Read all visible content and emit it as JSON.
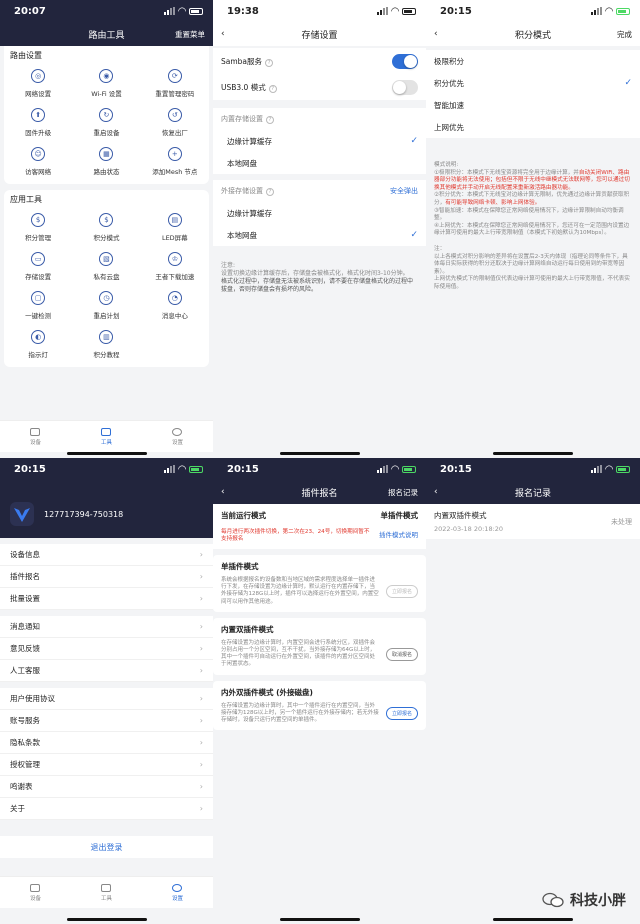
{
  "status": {
    "p1_time": "20:07",
    "p2_time": "19:38",
    "p3_time": "20:15",
    "p4_time": "20:15",
    "p5_time": "20:15",
    "p6_time": "20:15"
  },
  "p1": {
    "title": "路由工具",
    "right": "重置菜单",
    "section1": "路由设置",
    "router_items": [
      "网络设置",
      "Wi-Fi 设置",
      "重置管理密码",
      "固件升级",
      "重启设备",
      "恢复出厂",
      "访客网络",
      "路由状态",
      "添加Mesh 节点"
    ],
    "section2": "应用工具",
    "app_items": [
      "积分管理",
      "积分模式",
      "LED屏幕",
      "存储设置",
      "私有云盘",
      "王者下载加速",
      "一键检测",
      "重启计划",
      "消息中心",
      "指示灯",
      "积分教程"
    ],
    "tabs": [
      "设备",
      "工具",
      "设置"
    ]
  },
  "p2": {
    "title": "存储设置",
    "samba": "Samba服务",
    "usb": "USB3.0 模式",
    "internal_title": "内置存储设置",
    "internal_opts": [
      "边缘计算缓存",
      "本地网盘"
    ],
    "external_title": "外接存储设置",
    "eject": "安全弹出",
    "external_opts": [
      "边缘计算缓存",
      "本地网盘"
    ],
    "note_title": "注意:",
    "note_body": "设置切换边缘计算缓存后，存储盘会被格式化，格式化时间3-10分钟。",
    "note_body2": "格式化过程中，存储盘无法被系统识别，请不要在存储盘格式化的过程中拔盘，否则存储盘会有损坏的风险。"
  },
  "p3": {
    "title": "积分模式",
    "done": "完成",
    "options": [
      "极限积分",
      "积分优先",
      "智能加速",
      "上网优先"
    ],
    "explain_title": "模式说明:",
    "explain_1a": "①极限积分：本模式下无线宝资源将完全用于边缘计算，并",
    "explain_1b": "自动关闭WiFi、路由器部分功能将无法使用；包括但不限于无线中继模式无法联网等，您可以通过切换其他模式并手动开启无线配置来重新激活路由器功能。",
    "explain_2a": "②积分优先：本模式下无线宝对边缘计算无限制，优先通过边缘计算贡献获取积分，",
    "explain_2b": "有可能导致网络卡顿、影响上网体验。",
    "explain_3": "③智能加速：本模式在保障您正常网络使用情况下，边缘计算限制自动均衡调整。",
    "explain_4": "④上网优先：本模式在保障您正常网络使用情况下，您还可在一定范围内设置边缘计算可使用的最大上行带宽限制值（本模式下初始默认为10Mbps）。",
    "note_title": "注：",
    "note_1": "以上各模式对积分影响的差异将在设置后2-3天内体现（指理论同等条件下，具体每日实际获得的积分还取决于边缘计算网络自动运行每日使用到的带宽等因素）。",
    "note_2": "上网优先模式下的限制值仅代表边缘计算可使用的最大上行带宽限值，不代表实际使用值。"
  },
  "p4": {
    "account": "127717394-750318",
    "group1": [
      "设备信息",
      "插件报名",
      "批量设置"
    ],
    "group2": [
      "消息通知",
      "意见反馈",
      "人工客服"
    ],
    "group3": [
      "用户使用协议",
      "账号服务",
      "隐私条款",
      "授权管理",
      "鸣谢表",
      "关于"
    ],
    "logout": "退出登录",
    "tabs": [
      "设备",
      "工具",
      "设置"
    ]
  },
  "p5": {
    "title": "插件报名",
    "right": "报名记录",
    "current_label": "当前运行模式",
    "current_value": "单插件模式",
    "warning": "每月进行两次插件切换，第二次在23、24号，切换期间暂不支持报名",
    "mode_help": "插件模式说明",
    "cards": [
      {
        "title": "单插件模式",
        "body": "系统会根据报名的设备数和当地区域的需求程度选择单一插件进行下发，在存储设置为边缘计算时，默认运行在内置存储下，当外接存储为128G以上时，插件可以选择运行在外置空间，内置空间可以用作其他用途。",
        "btn": "立即报名"
      },
      {
        "title": "内置双插件模式",
        "body": "在存储设置为边缘计算时，内置空间会进行系统分区，双插件会分别占用一个分区空间，互不干扰，当外接存储为64G以上时，其中一个插件可自动运行在外置空间，该插件的内置分区空间处于闲置状态。",
        "btn": "取消报名"
      },
      {
        "title": "内外双插件模式 (外接磁盘)",
        "body": "在存储设置为边缘计算时，其中一个插件运行在内置空间，当外接存储为128G以上时，另一个插件运行在外接存储内；若无外接存储时，设备只运行内置空间的单插件。",
        "btn": "立即报名"
      }
    ]
  },
  "p6": {
    "title": "报名记录",
    "record_title": "内置双插件模式",
    "record_time": "2022-03-18 20:18:20",
    "record_status": "未处理"
  },
  "watermark": "科技小胖"
}
